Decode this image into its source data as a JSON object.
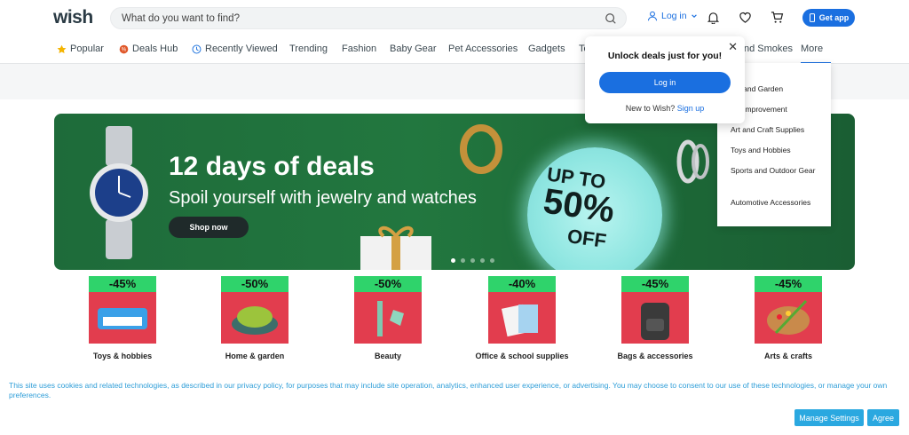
{
  "header": {
    "logo": "wish",
    "search_placeholder": "What do you want to find?",
    "login_label": "Log in",
    "get_app_label": "Get app"
  },
  "nav": {
    "items": [
      "Popular",
      "Deals Hub",
      "Recently Viewed",
      "Trending",
      "Fashion",
      "Baby Gear",
      "Pet Accessories",
      "Gadgets",
      "To",
      "nd Smokes",
      "More"
    ]
  },
  "banner": {
    "title": "12 days of deals",
    "subtitle": "Spoil yourself with jewelry and watches",
    "button": "Shop now",
    "promo_line1": "UP TO",
    "promo_line2": "50%",
    "promo_line3": "OFF"
  },
  "categories": [
    {
      "discount": "-45%",
      "label": "Toys & hobbies"
    },
    {
      "discount": "-50%",
      "label": "Home & garden"
    },
    {
      "discount": "-50%",
      "label": "Beauty"
    },
    {
      "discount": "-40%",
      "label": "Office & school supplies"
    },
    {
      "discount": "-45%",
      "label": "Bags & accessories"
    },
    {
      "discount": "-45%",
      "label": "Arts & crafts"
    }
  ],
  "more_menu": {
    "items": [
      "me and Garden",
      "me Improvement",
      "Art and Craft Supplies",
      "Toys and Hobbies",
      "Sports and Outdoor Gear",
      "Automotive Accessories"
    ]
  },
  "login_popup": {
    "title": "Unlock deals just for you!",
    "button": "Log in",
    "signup_prompt": "New to Wish?",
    "signup_link": "Sign up"
  },
  "cookie": {
    "text": "This site uses cookies and related technologies, as described in our privacy policy, for purposes that may include site operation, analytics, enhanced user experience, or advertising. You may choose to consent to our use of these technologies, or manage your own preferences.",
    "manage_label": "Manage Settings",
    "agree_label": "Agree"
  },
  "colors": {
    "accent": "#1a6fe0",
    "banner_green": "#1e6b3a",
    "category_red": "#e23d4e",
    "badge_green": "#2fd36b",
    "cookie_blue": "#2aa8e0"
  }
}
